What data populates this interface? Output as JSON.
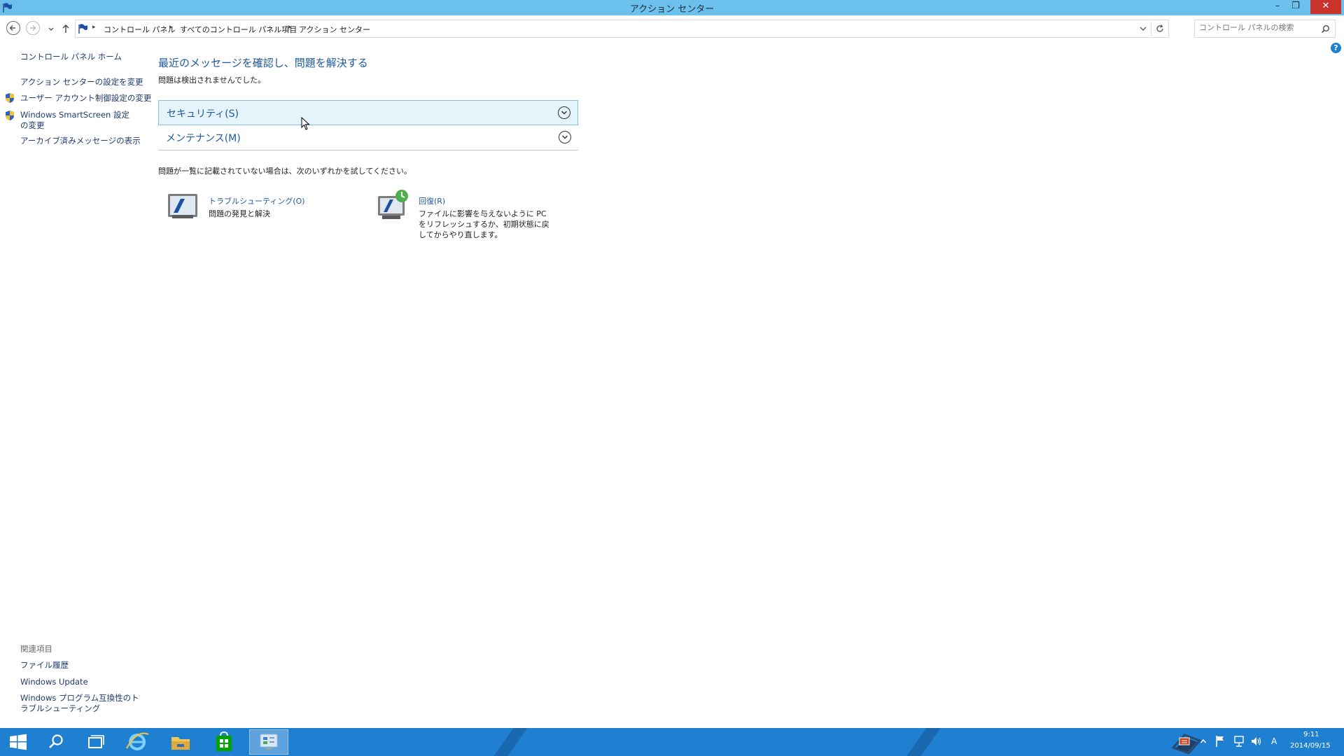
{
  "window": {
    "title": "アクション センター"
  },
  "breadcrumb": [
    "コントロール パネル",
    "すべてのコントロール パネル項目",
    "アクション センター"
  ],
  "search": {
    "placeholder": "コントロール パネルの検索"
  },
  "sidebar": {
    "home": "コントロール パネル ホーム",
    "links": [
      "アクション センターの設定を変更",
      "ユーザー アカウント制御設定の変更",
      "Windows SmartScreen 設定の変更",
      "アーカイブ済みメッセージの表示"
    ],
    "related_title": "関連項目",
    "related": [
      "ファイル履歴",
      "Windows Update",
      "Windows プログラム互換性のトラブルシューティング"
    ]
  },
  "main": {
    "title": "最近のメッセージを確認し、問題を解決する",
    "status": "問題は検出されませんでした。",
    "sections": [
      {
        "label": "セキュリティ(S)"
      },
      {
        "label": "メンテナンス(M)"
      }
    ],
    "hint": "問題が一覧に記載されていない場合は、次のいずれかを試してください。",
    "tools": [
      {
        "title": "トラブルシューティング(O)",
        "desc": "問題の発見と解決"
      },
      {
        "title": "回復(R)",
        "desc": "ファイルに影響を与えないように PC をリフレッシュするか、初期状態に戻してからやり直します。"
      }
    ]
  },
  "taskbar": {
    "time": "9:11",
    "date": "2014/09/15",
    "ime": "A"
  },
  "colors": {
    "titlebar": "#6cc0ec",
    "taskbar": "#1f7fd0",
    "link": "#1e5aa0",
    "close": "#c9332b"
  }
}
